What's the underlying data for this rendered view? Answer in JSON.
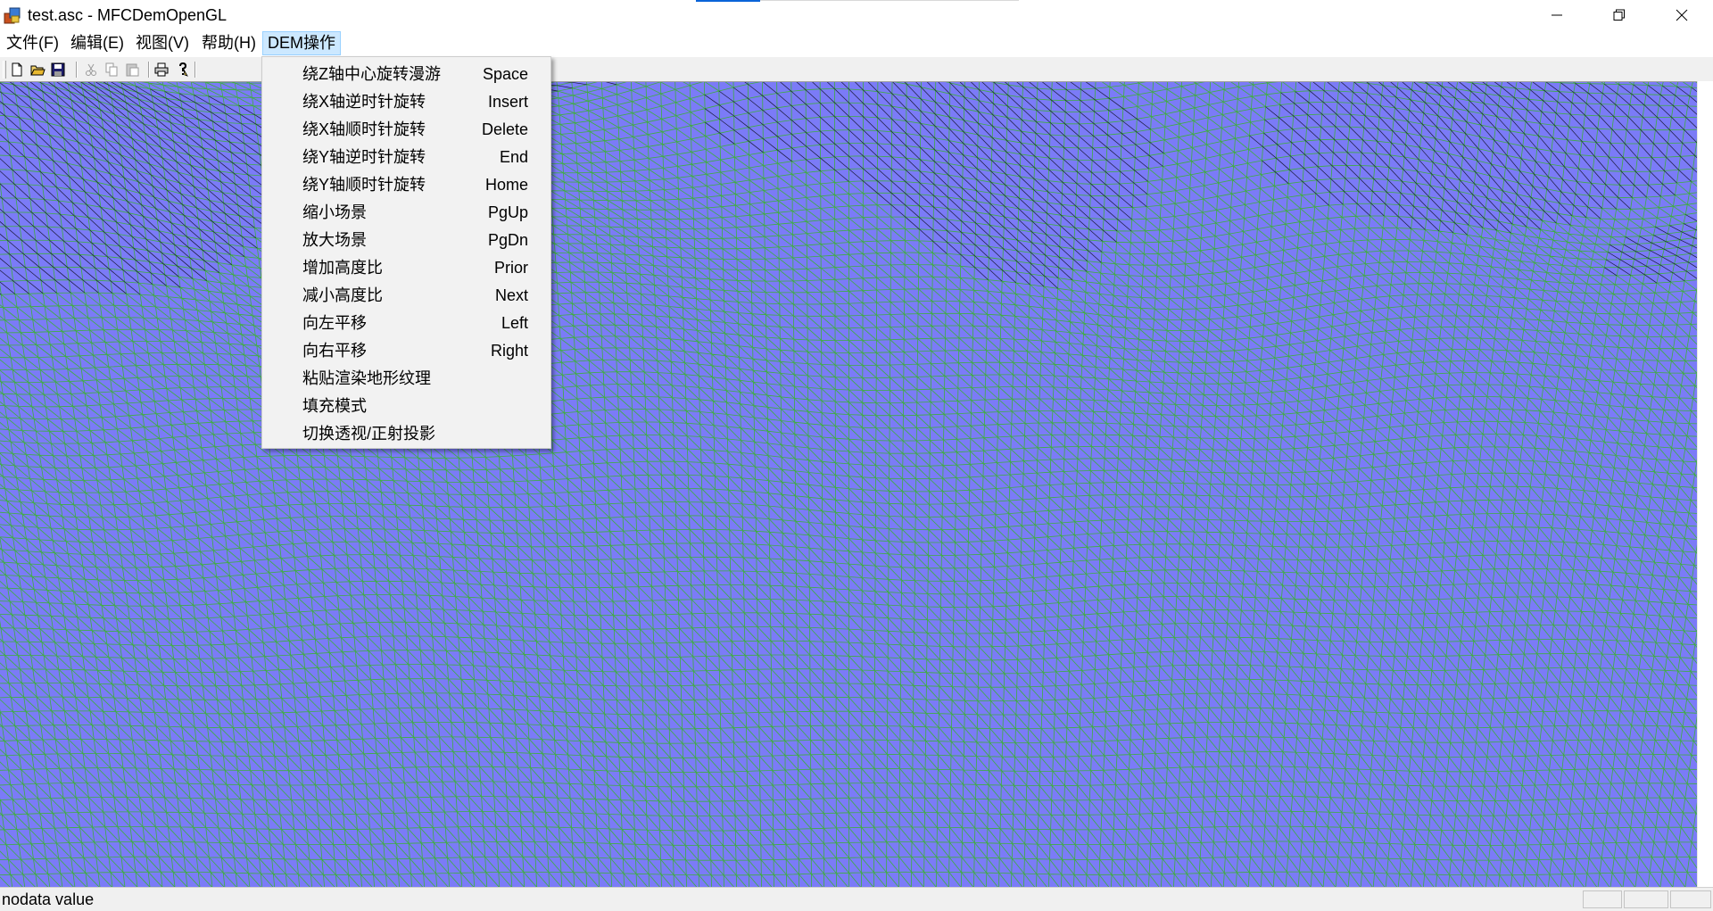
{
  "window": {
    "title": "test.asc - MFCDemOpenGL",
    "app_icon": "mfc-app-icon",
    "controls": [
      "minimize-icon",
      "restore-icon",
      "close-icon"
    ]
  },
  "menubar": {
    "items": [
      {
        "label": "文件(F)"
      },
      {
        "label": "编辑(E)"
      },
      {
        "label": "视图(V)"
      },
      {
        "label": "帮助(H)"
      },
      {
        "label": "DEM操作",
        "active": true
      }
    ]
  },
  "toolbar": {
    "buttons": [
      "new-icon",
      "open-icon",
      "save-icon",
      "cut-icon",
      "copy-icon",
      "paste-icon",
      "print-icon",
      "help-icon"
    ]
  },
  "dropdown": {
    "items": [
      {
        "label": "绕Z轴中心旋转漫游",
        "shortcut": "Space"
      },
      {
        "label": "绕X轴逆时针旋转",
        "shortcut": "Insert"
      },
      {
        "label": "绕X轴顺时针旋转",
        "shortcut": "Delete"
      },
      {
        "label": "绕Y轴逆时针旋转",
        "shortcut": "End"
      },
      {
        "label": "绕Y轴顺时针旋转",
        "shortcut": "Home"
      },
      {
        "label": "缩小场景",
        "shortcut": "PgUp"
      },
      {
        "label": "放大场景",
        "shortcut": "PgDn"
      },
      {
        "label": "增加高度比",
        "shortcut": "Prior"
      },
      {
        "label": "减小高度比",
        "shortcut": "Next"
      },
      {
        "label": "向左平移",
        "shortcut": "Left"
      },
      {
        "label": "向右平移",
        "shortcut": "Right"
      },
      {
        "label": "粘贴渲染地形纹理",
        "shortcut": ""
      },
      {
        "label": "填充模式",
        "shortcut": ""
      },
      {
        "label": "切换透视/正射投影",
        "shortcut": ""
      }
    ]
  },
  "viewport": {
    "background_color": "#7b7bf7",
    "mesh_color": "#3fae3f",
    "mesh_shadow_color": "#1a1a3a"
  },
  "statusbar": {
    "text": "nodata value"
  }
}
